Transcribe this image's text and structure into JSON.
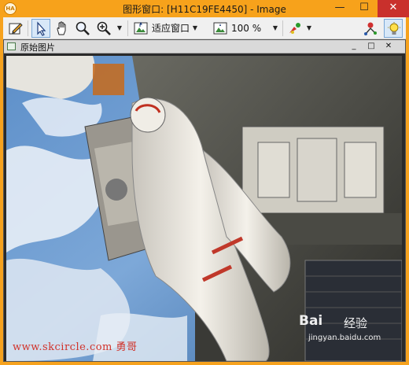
{
  "window": {
    "title": "图形窗口: [H11C19FE4450] - Image",
    "app_icon_text": "HA",
    "minimize_glyph": "—",
    "maximize_glyph": "☐",
    "close_glyph": "✕"
  },
  "toolbar": {
    "tools": [
      {
        "name": "edit-tool-icon"
      },
      {
        "name": "pointer-tool-icon",
        "active": true
      },
      {
        "name": "pan-hand-icon"
      },
      {
        "name": "zoom-magnifier-icon"
      },
      {
        "name": "zoom-in-icon"
      }
    ],
    "fit_mode": "适应窗口",
    "zoom_level": "100 %"
  },
  "document": {
    "title": "原始图片",
    "minimize_glyph": "_",
    "maximize_glyph": "□",
    "close_glyph": "✕"
  },
  "watermark": {
    "left_text": "www.skcircle.com 勇哥",
    "baidu_text": "Bai",
    "jingyan_text": "经验",
    "url_text": "jingyan.baidu.com"
  },
  "colors": {
    "title_bar": "#f7a21b",
    "close_button": "#c9302c",
    "watermark_red": "#d1322a"
  }
}
